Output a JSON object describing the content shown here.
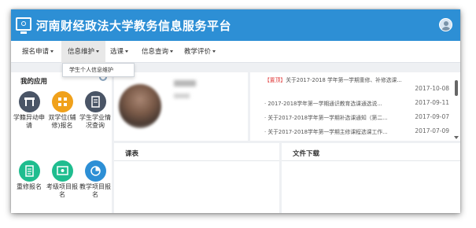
{
  "header": {
    "title": "河南财经政法大学教务信息服务平台"
  },
  "nav": [
    {
      "label": "报名申请"
    },
    {
      "label": "信息维护"
    },
    {
      "label": "选课"
    },
    {
      "label": "信息查询"
    },
    {
      "label": "教学评价"
    }
  ],
  "dropdown": {
    "item": "学生个人信息维护"
  },
  "apps": {
    "title": "我的应用",
    "items": [
      {
        "label": "学籍异动申请",
        "icon": "desk-icon",
        "color": "#4a5566"
      },
      {
        "label": "双学位(辅修)报名",
        "icon": "grid-icon",
        "color": "#f0a11b"
      },
      {
        "label": "学生学业情况查询",
        "icon": "book-icon",
        "color": "#4a5566"
      },
      {
        "label": "重修报名",
        "icon": "document-icon",
        "color": "#1fbd8f"
      },
      {
        "label": "考级项目报名",
        "icon": "certificate-icon",
        "color": "#1fbd8f"
      },
      {
        "label": "教学项目报名",
        "icon": "pie-chart-icon",
        "color": "#2d8fd5"
      }
    ]
  },
  "notices": [
    {
      "tag": "【置顶】",
      "text": "关于2017-2018 学年第一学期重修、补修选课...",
      "date": "2017-10-08"
    },
    {
      "tag": "",
      "text": "2017-2018学年第一学期通识教育选课通选说...",
      "date": "2017-09-11"
    },
    {
      "tag": "",
      "text": "关于2017-2018学年第一学期补选课通知（第二...",
      "date": "2017-09-07"
    },
    {
      "tag": "",
      "text": "关于2017-2018学年第一学期主修课程选课工作...",
      "date": "2017-07-09"
    }
  ],
  "panels": {
    "schedule_title": "课表",
    "downloads_title": "文件下载"
  },
  "colors": {
    "header": "#2d8fd5",
    "accent_red": "#e03a3a"
  }
}
